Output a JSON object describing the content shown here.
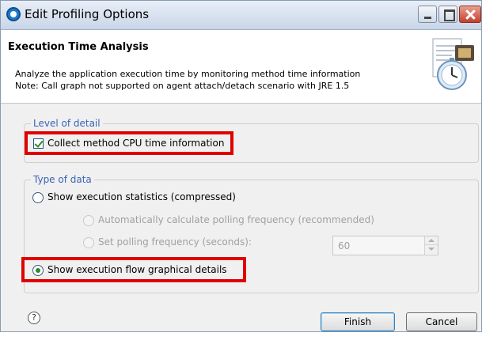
{
  "window": {
    "title": "Edit Profiling Options"
  },
  "header": {
    "title": "Execution Time Analysis",
    "description_line1": "Analyze the application execution time by monitoring method time information",
    "description_line2": "Note: Call graph not supported on agent attach/detach scenario with JRE 1.5"
  },
  "level_of_detail": {
    "legend": "Level of detail",
    "collect_cpu_label": "Collect method CPU time information",
    "collect_cpu_checked": true
  },
  "type_of_data": {
    "legend": "Type of data",
    "options": [
      {
        "label": "Show execution statistics (compressed)",
        "selected": false,
        "enabled": true
      },
      {
        "label": "Automatically calculate polling frequency (recommended)",
        "selected": false,
        "enabled": false
      },
      {
        "label": "Set polling frequency (seconds):",
        "selected": false,
        "enabled": false
      },
      {
        "label": "Show execution flow graphical details",
        "selected": true,
        "enabled": true
      }
    ],
    "polling_frequency_value": "60"
  },
  "footer": {
    "help_symbol": "?",
    "finish_label": "Finish",
    "cancel_label": "Cancel"
  },
  "colors": {
    "highlight": "#e00000",
    "legend": "#3b63b6"
  }
}
